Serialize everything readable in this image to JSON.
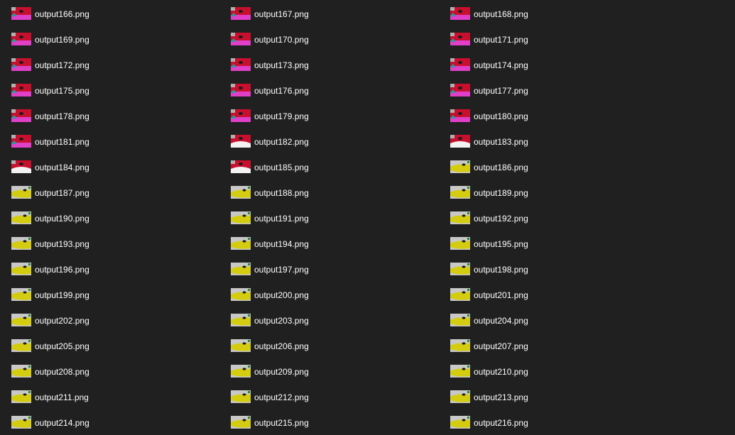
{
  "files": [
    {
      "name": "output166.png",
      "thumb": "red-magenta-thumbnail"
    },
    {
      "name": "output167.png",
      "thumb": "red-magenta-thumbnail"
    },
    {
      "name": "output168.png",
      "thumb": "red-magenta-thumbnail"
    },
    {
      "name": "output169.png",
      "thumb": "red-magenta-thumbnail"
    },
    {
      "name": "output170.png",
      "thumb": "red-magenta-thumbnail"
    },
    {
      "name": "output171.png",
      "thumb": "red-magenta-thumbnail"
    },
    {
      "name": "output172.png",
      "thumb": "red-magenta-thumbnail"
    },
    {
      "name": "output173.png",
      "thumb": "red-magenta-thumbnail"
    },
    {
      "name": "output174.png",
      "thumb": "red-magenta-thumbnail"
    },
    {
      "name": "output175.png",
      "thumb": "red-magenta-thumbnail"
    },
    {
      "name": "output176.png",
      "thumb": "red-magenta-thumbnail"
    },
    {
      "name": "output177.png",
      "thumb": "red-magenta-thumbnail"
    },
    {
      "name": "output178.png",
      "thumb": "red-magenta-thumbnail"
    },
    {
      "name": "output179.png",
      "thumb": "red-magenta-thumbnail"
    },
    {
      "name": "output180.png",
      "thumb": "red-magenta-thumbnail"
    },
    {
      "name": "output181.png",
      "thumb": "red-magenta-thumbnail"
    },
    {
      "name": "output182.png",
      "thumb": "red-white-thumbnail"
    },
    {
      "name": "output183.png",
      "thumb": "red-white-thumbnail"
    },
    {
      "name": "output184.png",
      "thumb": "red-white-thumbnail"
    },
    {
      "name": "output185.png",
      "thumb": "red-white-thumbnail"
    },
    {
      "name": "output186.png",
      "thumb": "yellow-gray-thumbnail"
    },
    {
      "name": "output187.png",
      "thumb": "yellow-gray-thumbnail"
    },
    {
      "name": "output188.png",
      "thumb": "yellow-gray-thumbnail"
    },
    {
      "name": "output189.png",
      "thumb": "yellow-gray-thumbnail"
    },
    {
      "name": "output190.png",
      "thumb": "yellow-gray-thumbnail"
    },
    {
      "name": "output191.png",
      "thumb": "yellow-gray-thumbnail"
    },
    {
      "name": "output192.png",
      "thumb": "yellow-gray-thumbnail"
    },
    {
      "name": "output193.png",
      "thumb": "yellow-gray-thumbnail"
    },
    {
      "name": "output194.png",
      "thumb": "yellow-gray-thumbnail"
    },
    {
      "name": "output195.png",
      "thumb": "yellow-gray-thumbnail"
    },
    {
      "name": "output196.png",
      "thumb": "yellow-gray-thumbnail"
    },
    {
      "name": "output197.png",
      "thumb": "yellow-gray-thumbnail"
    },
    {
      "name": "output198.png",
      "thumb": "yellow-gray-thumbnail"
    },
    {
      "name": "output199.png",
      "thumb": "yellow-gray-thumbnail"
    },
    {
      "name": "output200.png",
      "thumb": "yellow-gray-thumbnail"
    },
    {
      "name": "output201.png",
      "thumb": "yellow-gray-thumbnail"
    },
    {
      "name": "output202.png",
      "thumb": "yellow-gray-thumbnail"
    },
    {
      "name": "output203.png",
      "thumb": "yellow-gray-thumbnail"
    },
    {
      "name": "output204.png",
      "thumb": "yellow-gray-thumbnail"
    },
    {
      "name": "output205.png",
      "thumb": "yellow-gray-thumbnail"
    },
    {
      "name": "output206.png",
      "thumb": "yellow-gray-thumbnail"
    },
    {
      "name": "output207.png",
      "thumb": "yellow-gray-thumbnail"
    },
    {
      "name": "output208.png",
      "thumb": "yellow-gray-thumbnail"
    },
    {
      "name": "output209.png",
      "thumb": "yellow-gray-thumbnail"
    },
    {
      "name": "output210.png",
      "thumb": "yellow-gray-thumbnail"
    },
    {
      "name": "output211.png",
      "thumb": "yellow-gray-thumbnail"
    },
    {
      "name": "output212.png",
      "thumb": "yellow-gray-thumbnail"
    },
    {
      "name": "output213.png",
      "thumb": "yellow-gray-thumbnail"
    },
    {
      "name": "output214.png",
      "thumb": "yellow-gray-thumbnail"
    },
    {
      "name": "output215.png",
      "thumb": "yellow-gray-thumbnail"
    },
    {
      "name": "output216.png",
      "thumb": "yellow-gray-thumbnail"
    }
  ],
  "colors": {
    "background": "#202020",
    "text": "#ffffff",
    "thumb_red": "#c8102e",
    "thumb_magenta": "#e040c8",
    "thumb_white": "#f2f2f2",
    "thumb_yellow": "#d4cc10",
    "thumb_gray": "#c8c8c8"
  }
}
